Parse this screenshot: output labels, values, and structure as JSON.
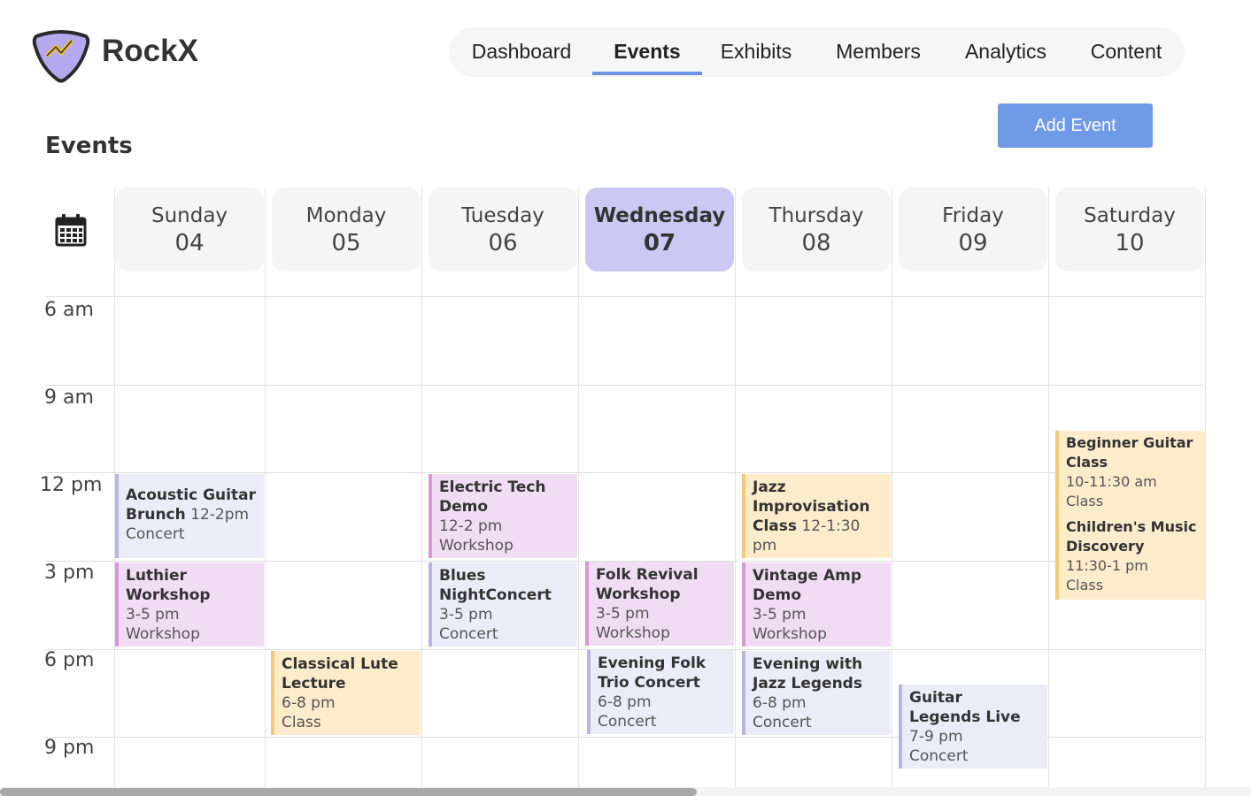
{
  "brand": {
    "name": "RockX"
  },
  "nav": {
    "tabs": [
      {
        "label": "Dashboard",
        "active": false
      },
      {
        "label": "Events",
        "active": true
      },
      {
        "label": "Exhibits",
        "active": false
      },
      {
        "label": "Members",
        "active": false
      },
      {
        "label": "Analytics",
        "active": false
      },
      {
        "label": "Content",
        "active": false
      }
    ]
  },
  "page": {
    "title": "Events",
    "add_button": "Add Event"
  },
  "calendar": {
    "icon": "calendar-icon",
    "days": [
      {
        "name": "Sunday",
        "num": "04",
        "active": false
      },
      {
        "name": "Monday",
        "num": "05",
        "active": false
      },
      {
        "name": "Tuesday",
        "num": "06",
        "active": false
      },
      {
        "name": "Wednesday",
        "num": "07",
        "active": true
      },
      {
        "name": "Thursday",
        "num": "08",
        "active": false
      },
      {
        "name": "Friday",
        "num": "09",
        "active": false
      },
      {
        "name": "Saturday",
        "num": "10",
        "active": false
      }
    ],
    "times": [
      "6 am",
      "9 am",
      "12 pm",
      "3 pm",
      "6 pm",
      "9 pm"
    ],
    "events": [
      {
        "title": "Acoustic Guitar Brunch",
        "time": "12-2pm",
        "type": "Concert"
      },
      {
        "title": "Luthier Workshop",
        "time": "3-5 pm",
        "type": "Workshop"
      },
      {
        "title": "Classical Lute Lecture",
        "time": "6-8 pm",
        "type": "Class"
      },
      {
        "title": "Electric Tech Demo",
        "time": "12-2 pm",
        "type": "Workshop"
      },
      {
        "title": "Blues NightConcert",
        "time": "3-5 pm",
        "type": "Concert"
      },
      {
        "title": "Folk Revival Workshop",
        "time": "3-5 pm",
        "type": "Workshop"
      },
      {
        "title": "Evening Folk Trio Concert",
        "time": "6-8 pm",
        "type": "Concert"
      },
      {
        "title": "Jazz Improvisation Class",
        "time": "12-1:30 pm",
        "type": "Class"
      },
      {
        "title": "Vintage Amp Demo",
        "time": "3-5 pm",
        "type": "Workshop"
      },
      {
        "title": "Evening with Jazz Legends",
        "time": "6-8 pm",
        "type": "Concert"
      },
      {
        "title": "Guitar Legends Live",
        "time": "7-9 pm",
        "type": "Concert"
      },
      {
        "title": "Beginner Guitar Class",
        "time": "10-11:30 am",
        "type": "Class"
      },
      {
        "title": "Children's Music Discovery",
        "time": "11:30-1 pm",
        "type": "Class"
      }
    ]
  },
  "colors": {
    "accent": "#6f94e6",
    "button": "#6f9ae8",
    "active_day": "#cdc8f3",
    "class_bg": "#fdeccc",
    "workshop_bg": "#f0dcf3",
    "concert_bg": "#ececf8"
  }
}
